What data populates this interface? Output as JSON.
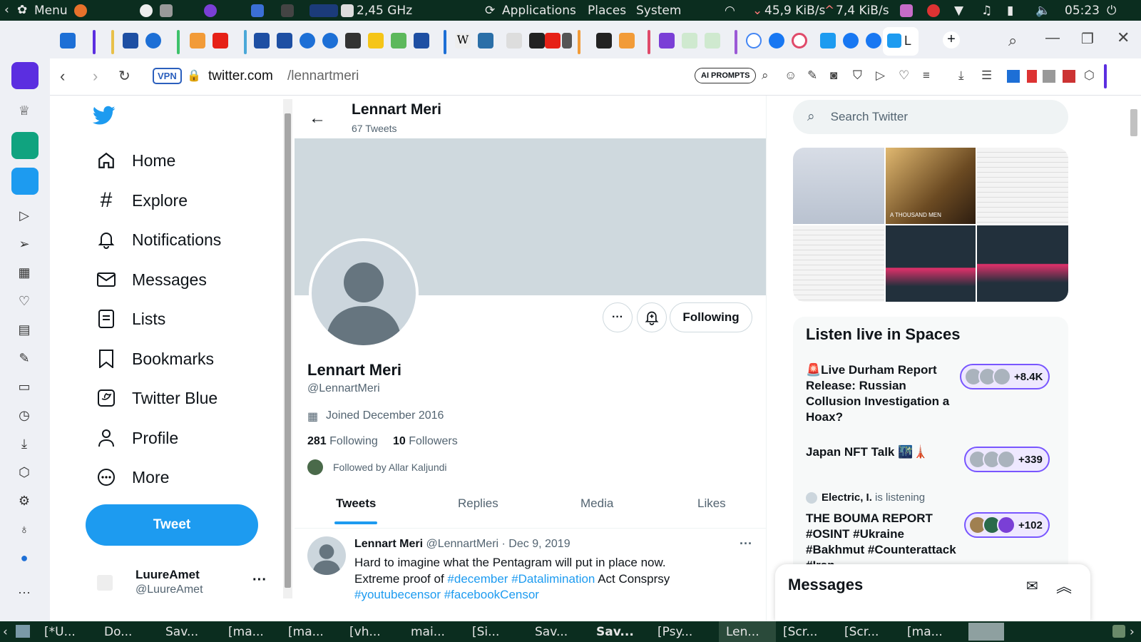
{
  "system_panel": {
    "menu_label": "Menu",
    "cpu_freq": "2,45 GHz",
    "applications": "Applications",
    "places": "Places",
    "system": "System",
    "net_down": "45,9 KiB/s",
    "net_up": "7,4 KiB/s",
    "clock": "05:23"
  },
  "browser": {
    "active_tab_label": "L",
    "vpn_badge": "VPN",
    "url_domain": "twitter.com",
    "url_path": "/lennartmeri",
    "ai_prompts": "AI PROMPTS"
  },
  "twitter": {
    "nav": [
      {
        "label": "Home",
        "icon": "home-icon"
      },
      {
        "label": "Explore",
        "icon": "hashtag-icon"
      },
      {
        "label": "Notifications",
        "icon": "bell-icon"
      },
      {
        "label": "Messages",
        "icon": "envelope-icon"
      },
      {
        "label": "Lists",
        "icon": "list-icon"
      },
      {
        "label": "Bookmarks",
        "icon": "bookmark-icon"
      },
      {
        "label": "Twitter Blue",
        "icon": "twitter-blue-icon"
      },
      {
        "label": "Profile",
        "icon": "person-icon"
      },
      {
        "label": "More",
        "icon": "more-circle-icon"
      }
    ],
    "tweet_button": "Tweet",
    "account": {
      "name": "LuureAmet",
      "handle": "@LuureAmet"
    },
    "header": {
      "name": "Lennart Meri",
      "tweet_count": "67 Tweets"
    },
    "profile": {
      "name": "Lennart Meri",
      "handle": "@LennartMeri",
      "joined": "Joined December 2016",
      "following_count": "281",
      "following_label": "Following",
      "followers_count": "10",
      "followers_label": "Followers",
      "followed_by": "Followed by Allar Kaljundi",
      "following_button": "Following"
    },
    "tabs": [
      "Tweets",
      "Replies",
      "Media",
      "Likes"
    ],
    "tweet": {
      "name": "Lennart Meri",
      "meta": "@LennartMeri · Dec 9, 2019",
      "line1": "Hard to imagine what the Pentagram will put in place now.",
      "line2_prefix": "Extreme proof of",
      "hashtag1": "#december",
      "hashtag2": "#Datalimination",
      "line2_suffix": "Act Consprsy",
      "hashtag3": "#youtubecensor",
      "hashtag4": "#facebookCensor"
    },
    "search_placeholder": "Search Twitter",
    "media_caption": "A THOUSAND MEN",
    "spaces": {
      "title": "Listen live in Spaces",
      "items": [
        {
          "title": "🚨Live Durham Report Release: Russian Collusion Investigation a Hoax?",
          "count": "+8.4K"
        },
        {
          "title": "Japan NFT Talk 🌃🗼",
          "count": "+339"
        },
        {
          "listener_name": "Electric, I.",
          "listener_suffix": "is listening",
          "title": "THE BOUMA REPORT #OSINT #Ukraine #Bakhmut #Counterattack #Iran",
          "count": "+102"
        }
      ]
    },
    "messages_title": "Messages"
  },
  "taskbar": [
    "[*U...",
    "Do...",
    "Sav...",
    "[ma...",
    "[ma...",
    "[vh...",
    "mai...",
    "[Si...",
    "Sav...",
    "Sav...",
    "[Psy...",
    "Len...",
    "[Scr...",
    "[Scr...",
    "[ma..."
  ],
  "colors": {
    "accent": "#1d9bf0",
    "spaces": "#7856ff",
    "panel": "#0b2d1f"
  }
}
